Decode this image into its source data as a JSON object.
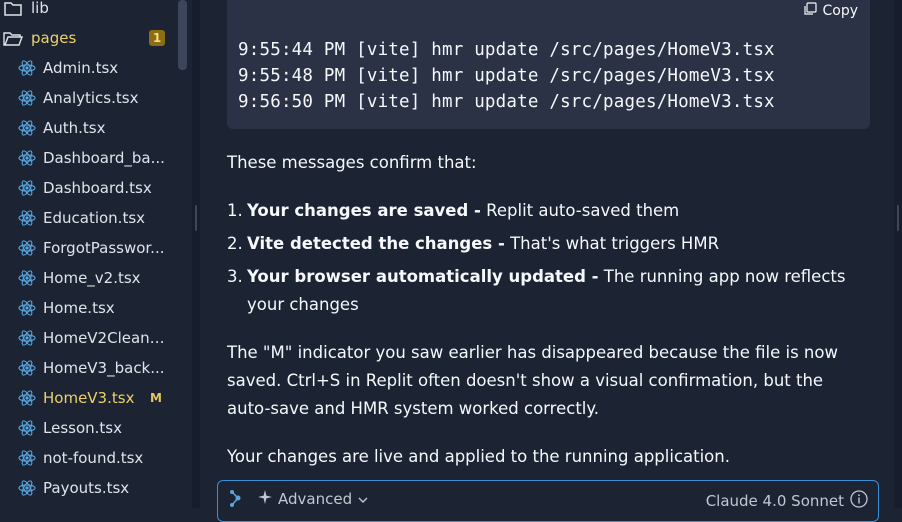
{
  "sidebar": {
    "folders": [
      {
        "label": "lib"
      },
      {
        "label": "pages",
        "badge": "1"
      }
    ],
    "files": [
      {
        "label": "Admin.tsx"
      },
      {
        "label": "Analytics.tsx"
      },
      {
        "label": "Auth.tsx"
      },
      {
        "label": "Dashboard_ba..."
      },
      {
        "label": "Dashboard.tsx"
      },
      {
        "label": "Education.tsx"
      },
      {
        "label": "ForgotPasswor..."
      },
      {
        "label": "Home_v2.tsx"
      },
      {
        "label": "Home.tsx"
      },
      {
        "label": "HomeV2Clean...."
      },
      {
        "label": "HomeV3_back..."
      },
      {
        "label": "HomeV3.tsx",
        "status": "M"
      },
      {
        "label": "Lesson.tsx"
      },
      {
        "label": "not-found.tsx"
      },
      {
        "label": "Payouts.tsx"
      }
    ]
  },
  "code": {
    "copy_label": "Copy",
    "lines": [
      "9:55:44 PM [vite] hmr update /src/pages/HomeV3.tsx",
      "9:55:48 PM [vite] hmr update /src/pages/HomeV3.tsx",
      "9:56:50 PM [vite] hmr update /src/pages/HomeV3.tsx"
    ]
  },
  "message": {
    "intro": "These messages confirm that:",
    "list": [
      {
        "num": "1.",
        "bold": "Your changes are saved -",
        "text": " Replit auto-saved them"
      },
      {
        "num": "2.",
        "bold": "Vite detected the changes -",
        "text": " That's what triggers HMR"
      },
      {
        "num": "3.",
        "bold": "Your browser automatically updated -",
        "text": " The running app now reflects your changes"
      }
    ],
    "para2": "The \"M\" indicator you saw earlier has disappeared because the file is now saved. Ctrl+S in Replit often doesn't show a visual confirmation, but the auto-save and HMR system worked correctly.",
    "para3": "Your changes are live and applied to the running application."
  },
  "composer": {
    "mode_label": "Advanced",
    "model_label": "Claude 4.0 Sonnet"
  },
  "colors": {
    "background": "#1c2333",
    "code_bg": "#2b3245",
    "modified": "#ecd16a",
    "focus_border": "#3a8fd6",
    "react_icon": "#58a6e0"
  }
}
